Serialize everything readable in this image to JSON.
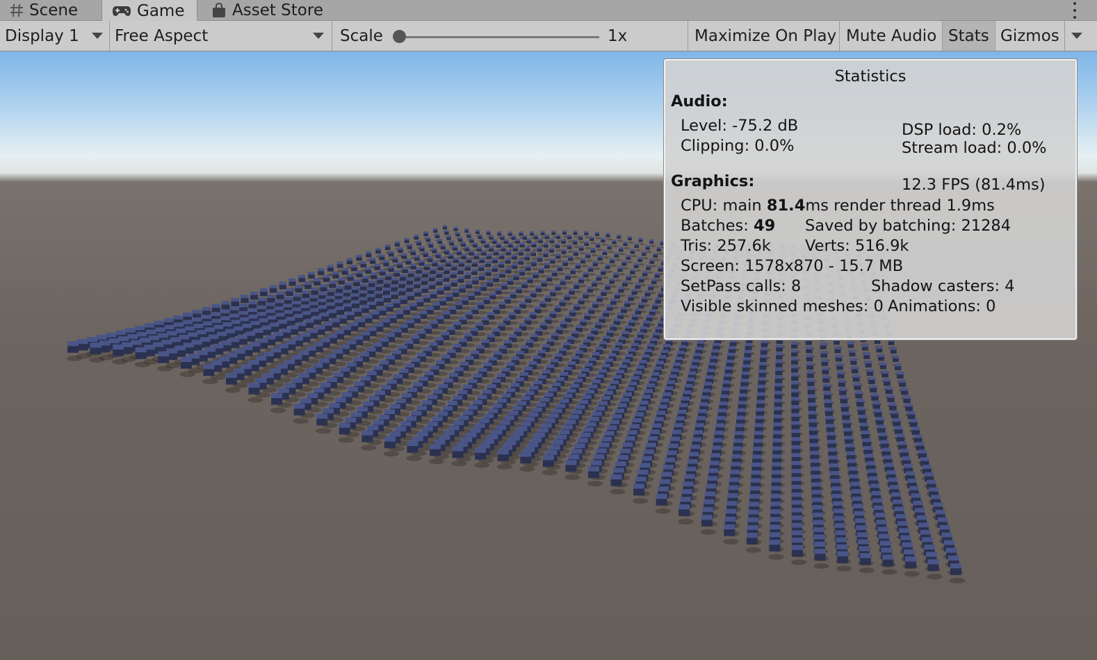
{
  "tabs": [
    {
      "label": "Scene",
      "icon": "hash-icon",
      "active": false
    },
    {
      "label": "Game",
      "icon": "gamepad-icon",
      "active": true
    },
    {
      "label": "Asset Store",
      "icon": "shopping-bag-icon",
      "active": false
    }
  ],
  "toolbar": {
    "display": "Display 1",
    "aspect": "Free Aspect",
    "scale_label": "Scale",
    "scale_value": "1x",
    "scale_slider_fraction": 0.0,
    "maximize": "Maximize On Play",
    "mute": "Mute Audio",
    "stats": "Stats",
    "gizmos": "Gizmos"
  },
  "stats": {
    "title": "Statistics",
    "audio_header": "Audio:",
    "level": "Level: -75.2 dB",
    "clipping": "Clipping: 0.0%",
    "dsp": "DSP load: 0.2%",
    "stream": "Stream load: 0.0%",
    "graphics_header": "Graphics:",
    "fps": "12.3 FPS (81.4ms)",
    "cpu_prefix": "CPU: main ",
    "cpu_main": "81.4",
    "cpu_suffix": "ms  render thread 1.9ms",
    "batches_prefix": "Batches: ",
    "batches": "49",
    "saved": "Saved by batching: 21284",
    "tris": "Tris: 257.6k",
    "verts": "Verts: 516.9k",
    "screen": "Screen: 1578x870 - 15.7 MB",
    "setpass": "SetPass calls: 8",
    "shadow": "Shadow casters: 4",
    "skinned": "Visible skinned meshes: 0",
    "animations": "Animations: 0"
  },
  "colors": {
    "cube_top": "#4a5587",
    "cube_side": "#2b3150",
    "sky": "#9cc8ee",
    "ground": "#6d6560"
  }
}
